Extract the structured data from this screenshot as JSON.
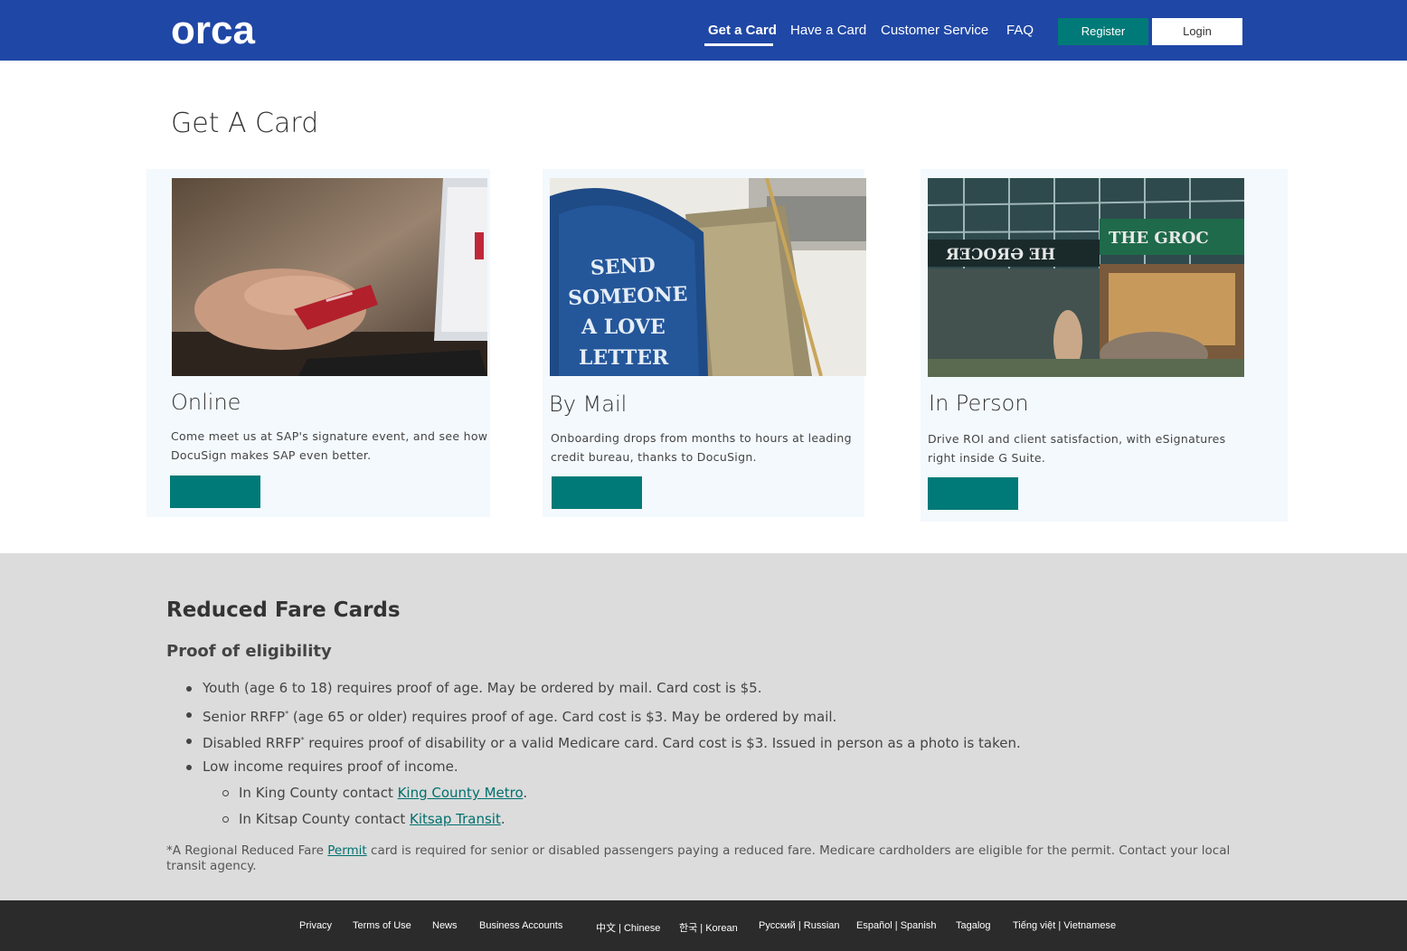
{
  "header": {
    "logo": "orca",
    "nav": [
      "Get a Card",
      "Have a Card",
      "Customer Service",
      "FAQ"
    ],
    "register": "Register",
    "login": "Login"
  },
  "page_title": "Get A Card",
  "cards": [
    {
      "title": "Online",
      "desc": "Come meet us at SAP's signature event, and see how DocuSign makes SAP even better.",
      "image": "hand-holding-credit-card-laptop"
    },
    {
      "title": "By Mail",
      "desc": "Onboarding drops from months to hours at leading credit bureau, thanks to DocuSign.",
      "image": "blue-mailbox-send-someone-a-love-letter"
    },
    {
      "title": "In Person",
      "desc": "Drive ROI and client satisfaction, with  eSignatures right inside G Suite.",
      "image": "storefront-the-grocer"
    }
  ],
  "reduced": {
    "title": "Reduced Fare Cards",
    "subtitle": "Proof of eligibility",
    "items": [
      "Youth (age 6 to 18) requires proof of age. May be ordered by mail. Card cost is $5.",
      "(age 65 or older) requires proof of age. Card cost is $3. May be ordered by mail.",
      "requires proof of disability or a valid Medicare card. Card cost is $3. Issued in person as a photo is taken.",
      "Low income requires proof of income."
    ],
    "senior_prefix": "Senior RRFP",
    "disabled_prefix": "Disabled RRFP",
    "star": "*",
    "king_prefix": "In King County contact ",
    "king_link": "King County Metro",
    "kitsap_prefix": "In Kitsap County contact ",
    "kitsap_link": "Kitsap Transit",
    "period": ".",
    "note_prefix": "*A Regional Reduced Fare ",
    "note_link": "Permit",
    "note_rest": " card is required for senior or disabled passengers paying a reduced fare. Medicare cardholders are eligible for the permit. Contact your local transit agency."
  },
  "footer": {
    "links": [
      "Privacy",
      "Terms of Use",
      "News",
      "Business Accounts"
    ],
    "languages": [
      "中文 | Chinese",
      "한국 | Korean",
      "Русский | Russian",
      "Español | Spanish",
      "Tagalog",
      "Tiếng việt | Vietnamese"
    ]
  }
}
